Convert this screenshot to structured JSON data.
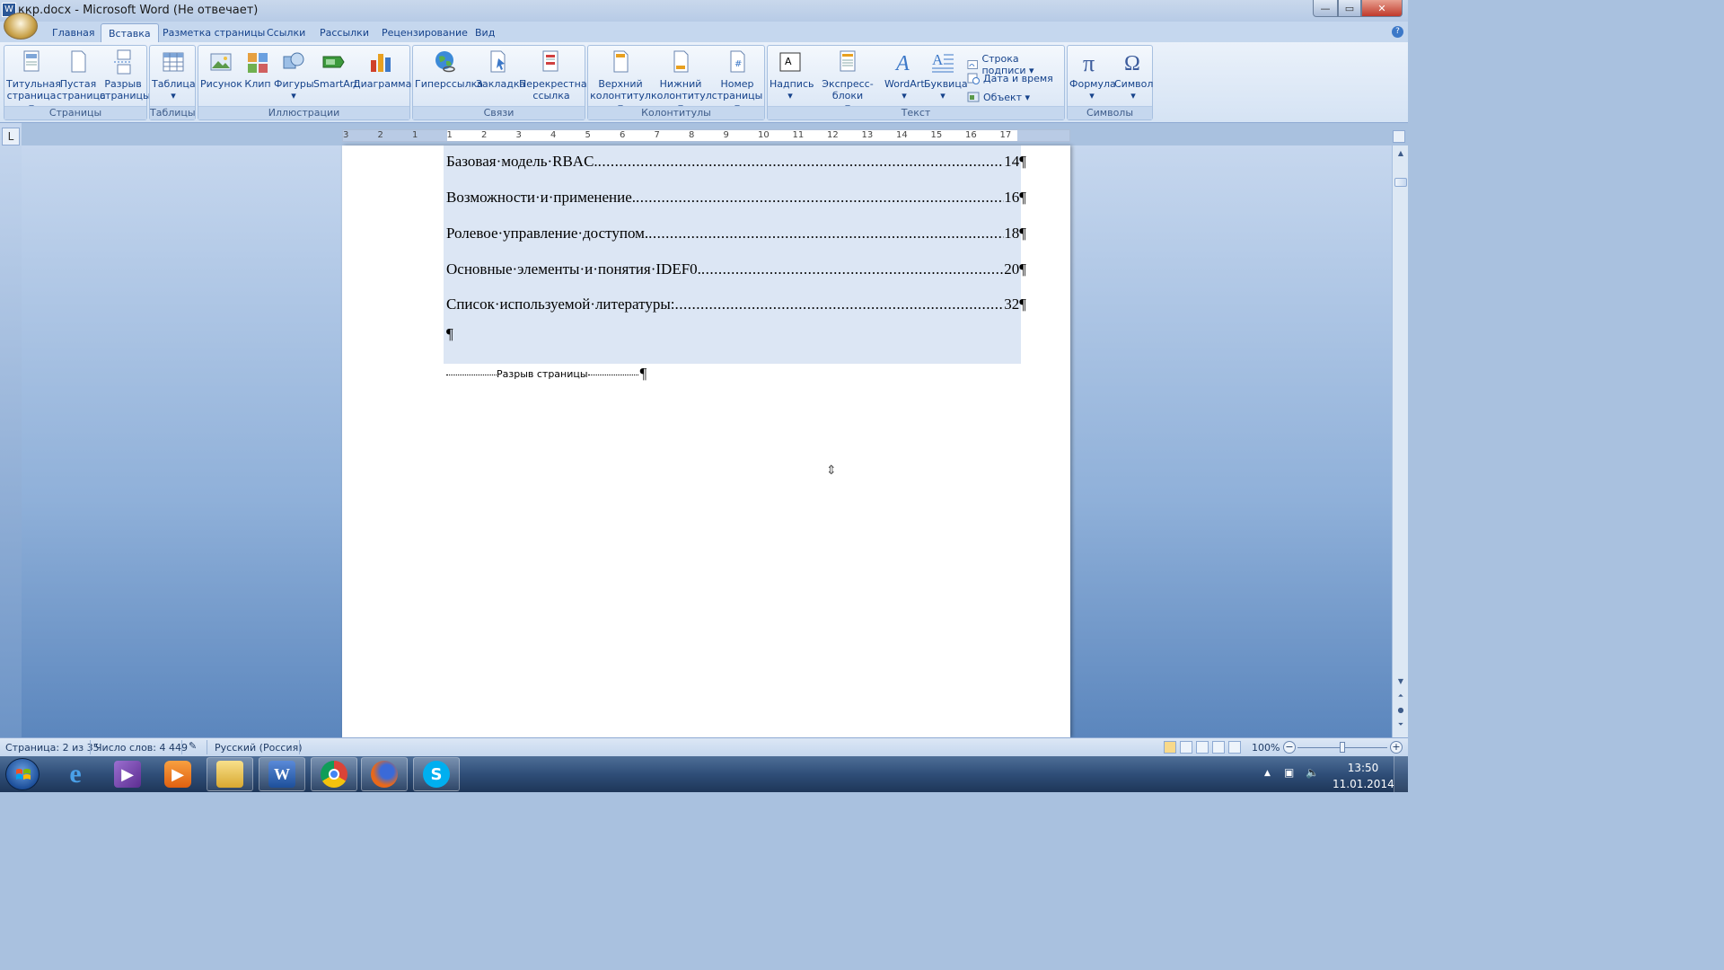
{
  "window": {
    "title": "ккр.docx - Microsoft Word (Не отвечает)",
    "min_glyph": "—",
    "max_glyph": "▭",
    "close_glyph": "✕"
  },
  "tabs": [
    "Главная",
    "Вставка",
    "Разметка страницы",
    "Ссылки",
    "Рассылки",
    "Рецензирование",
    "Вид"
  ],
  "active_tab": "Вставка",
  "ribbon": {
    "groups": {
      "pages": "Страницы",
      "tables": "Таблицы",
      "illustrations": "Иллюстрации",
      "links": "Связи",
      "headers": "Колонтитулы",
      "text": "Текст",
      "symbols": "Символы"
    },
    "buttons": {
      "title_page": [
        "Титульная",
        "страница ▾"
      ],
      "blank_page": [
        "Пустая",
        "страница"
      ],
      "page_break": [
        "Разрыв",
        "страницы"
      ],
      "table": [
        "Таблица",
        "▾"
      ],
      "picture": [
        "Рисунок",
        ""
      ],
      "clip": [
        "Клип",
        ""
      ],
      "shapes": [
        "Фигуры",
        "▾"
      ],
      "smartart": [
        "SmartArt",
        ""
      ],
      "chart": [
        "Диаграмма",
        ""
      ],
      "hyperlink": [
        "Гиперссылка",
        ""
      ],
      "bookmark": [
        "Закладка",
        ""
      ],
      "cross_ref": [
        "Перекрестная",
        "ссылка"
      ],
      "header": [
        "Верхний",
        "колонтитул ▾"
      ],
      "footer": [
        "Нижний",
        "колонтитул ▾"
      ],
      "page_number": [
        "Номер",
        "страницы ▾"
      ],
      "textbox": [
        "Надпись",
        "▾"
      ],
      "quick_parts": [
        "Экспресс-блоки",
        "▾"
      ],
      "wordart": [
        "WordArt",
        "▾"
      ],
      "dropcap": [
        "Буквица",
        "▾"
      ],
      "formula": [
        "Формула",
        "▾"
      ],
      "symbol": [
        "Символ",
        "▾"
      ]
    },
    "small_buttons": {
      "signature_line": "Строка подписи ▾",
      "date_time": "Дата и время",
      "object": "Объект ▾"
    }
  },
  "ruler": {
    "corner": "L",
    "labels": [
      "3",
      "2",
      "1",
      "1",
      "2",
      "3",
      "4",
      "5",
      "6",
      "7",
      "8",
      "9",
      "10",
      "11",
      "12",
      "13",
      "14",
      "15",
      "16",
      "17"
    ]
  },
  "document": {
    "toc": [
      {
        "title": "Базовая·модель·RBAC.",
        "page": "14¶"
      },
      {
        "title": "Возможности·и·применение.",
        "page": "16¶"
      },
      {
        "title": "Ролевое·управление·доступом.",
        "page": "18¶"
      },
      {
        "title": "Основные·элементы·и·понятия·IDEF0.",
        "page": "20¶"
      },
      {
        "title": "Список·используемой·литературы:",
        "page": "32¶"
      }
    ],
    "dots": "...................................................................................................................................................",
    "empty_paragraph": "¶",
    "page_break_label": "Разрыв страницы",
    "page_break_mark": "¶"
  },
  "statusbar": {
    "page": "Страница: 2 из 35",
    "words": "Число слов: 4 449",
    "language": "Русский (Россия)",
    "zoom": "100%",
    "zoom_minus": "−",
    "zoom_plus": "+"
  },
  "taskbar": {
    "clock_time": "13:50",
    "clock_date": "11.01.2014",
    "tray_arrow": "▲"
  }
}
